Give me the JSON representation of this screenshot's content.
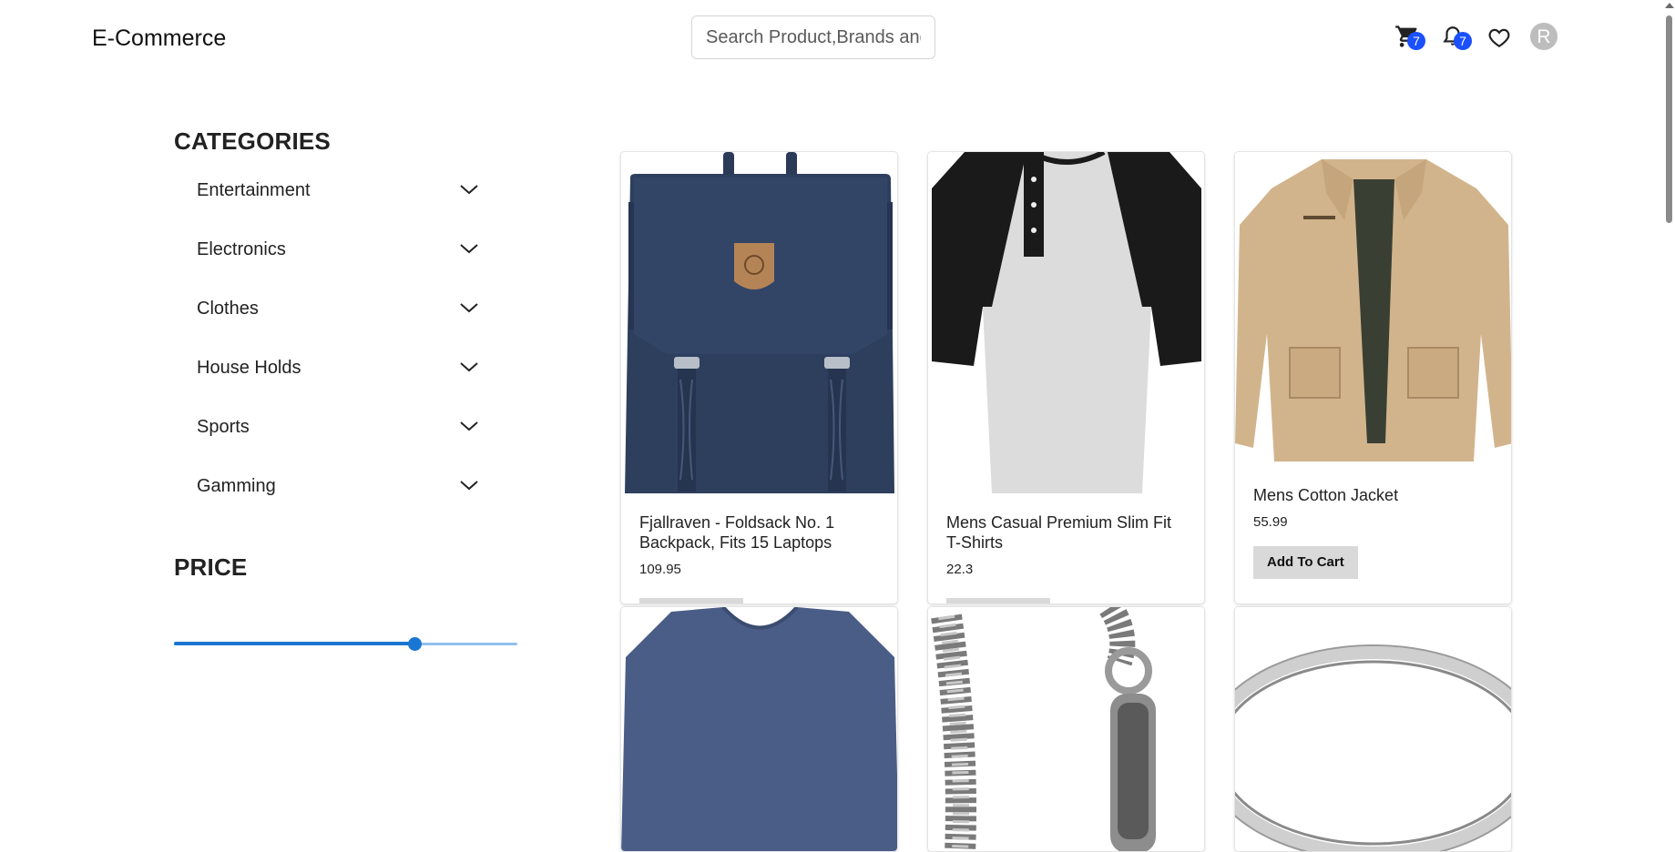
{
  "header": {
    "brand": "E-Commerce",
    "search_placeholder": "Search Product,Brands and More",
    "cart_count": "7",
    "notification_count": "7",
    "avatar_letter": "R"
  },
  "sidebar": {
    "categories_title": "CATEGORIES",
    "categories": [
      {
        "label": "Entertainment"
      },
      {
        "label": "Electronics"
      },
      {
        "label": "Clothes"
      },
      {
        "label": "House Holds"
      },
      {
        "label": "Sports"
      },
      {
        "label": "Gamming"
      }
    ],
    "price_title": "PRICE",
    "price_slider_fraction": 0.7
  },
  "products": [
    {
      "title": "Fjallraven - Foldsack No. 1 Backpack, Fits 15 Laptops",
      "price": "109.95",
      "image": "backpack"
    },
    {
      "title": "Mens Casual Premium Slim Fit T-Shirts",
      "price": "22.3",
      "image": "raglan-tshirt"
    },
    {
      "title": "Mens Cotton Jacket",
      "price": "55.99",
      "image": "jacket",
      "button": "Add To Cart"
    },
    {
      "image": "long-sleeve-shirt"
    },
    {
      "image": "chain-bracelet"
    },
    {
      "image": "silver-ring"
    }
  ],
  "colors": {
    "accent": "#1976d2",
    "badge": "#1a50ff",
    "button_bg": "#d9d9d9"
  }
}
